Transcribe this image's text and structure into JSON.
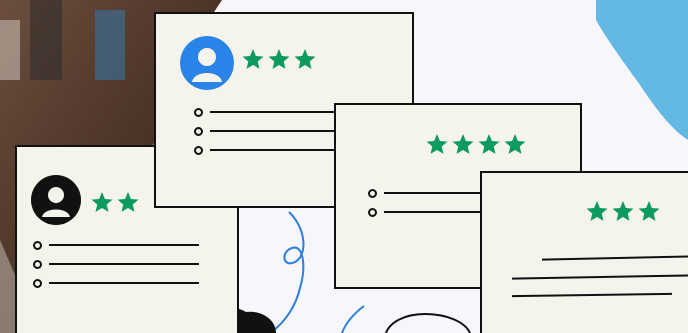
{
  "colors": {
    "star_green": "#0c9a5e",
    "avatar_blue": "#2a84e8",
    "avatar_black": "#111111",
    "card_fill": "#f4f3ec",
    "ink": "#111111",
    "sky_blue": "#63b9e3",
    "doodle_blue": "#2a7fe0",
    "photo_brown": "#4c3427"
  },
  "reviews": [
    {
      "id": "review-card-1",
      "rating": 2,
      "avatar": "black",
      "bullet_lines": 3
    },
    {
      "id": "review-card-2",
      "rating": 3,
      "avatar": "blue",
      "bullet_lines": 3
    },
    {
      "id": "review-card-3",
      "rating": 4,
      "avatar": "none",
      "bullet_lines": 2
    },
    {
      "id": "review-card-4",
      "rating": 3,
      "avatar": "none",
      "bullet_lines": 0
    }
  ],
  "icons": {
    "star": "star-icon",
    "avatar": "user-avatar-icon",
    "bullet": "bullet-icon"
  }
}
